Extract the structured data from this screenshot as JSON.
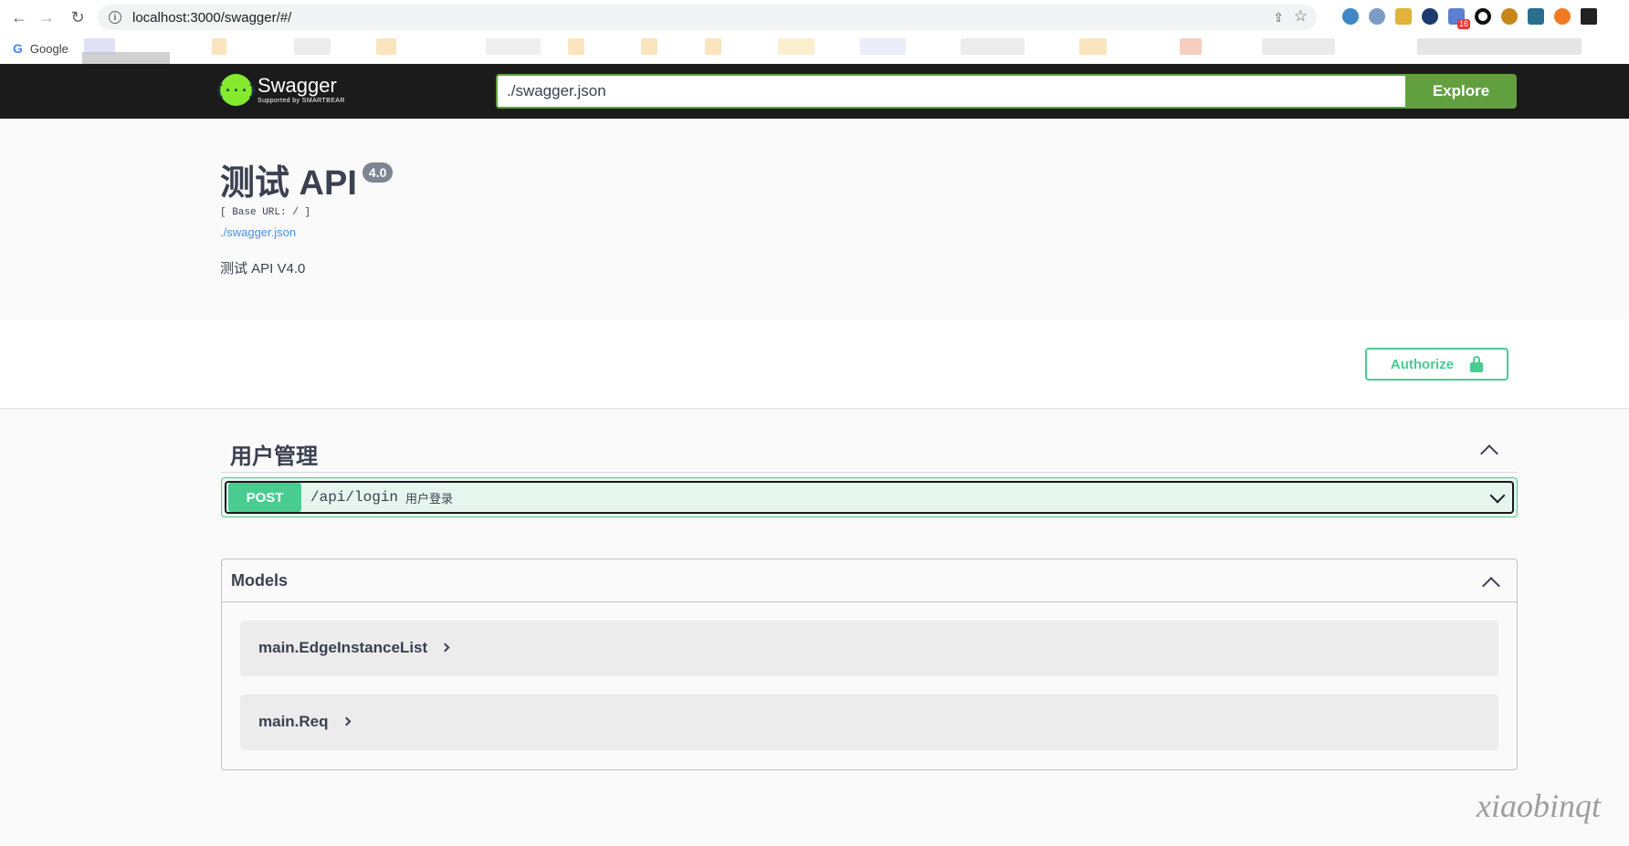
{
  "browser": {
    "url": "localhost:3000/swagger/#/",
    "bookmark_google": "Google",
    "extension_badge": "16"
  },
  "topbar": {
    "logo_name": "Swagger",
    "logo_sub": "Supported by SMARTBEAR",
    "spec_url": "./swagger.json",
    "explore_label": "Explore"
  },
  "info": {
    "title": "测试 API",
    "version": "4.0",
    "base_url": "[ Base URL: / ]",
    "spec_link": "./swagger.json",
    "description": "测试 API V4.0"
  },
  "auth": {
    "authorize_label": "Authorize"
  },
  "tag": {
    "name": "用户管理",
    "operations": [
      {
        "method": "POST",
        "path": "/api/login",
        "summary": "用户登录"
      }
    ]
  },
  "models": {
    "title": "Models",
    "items": [
      "main.EdgeInstanceList",
      "main.Req"
    ]
  },
  "colors": {
    "post": "#49cc90",
    "topbar_bg": "#1b1b1b",
    "explore": "#62a03f",
    "link": "#4990e2"
  },
  "watermark": "xiaobinqt"
}
